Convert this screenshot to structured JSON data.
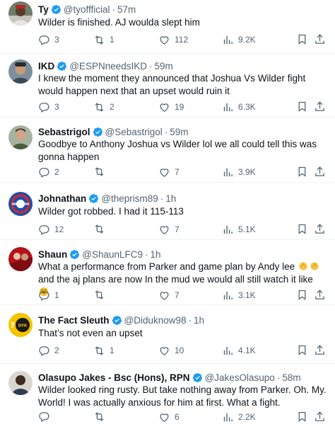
{
  "tweets": [
    {
      "name": "Ty",
      "handle": "@tyoffficial",
      "time": "57m",
      "text": "Wilder is finished. AJ woulda slept him",
      "replies": "3",
      "retweets": "1",
      "likes": "112",
      "views": "9.2K",
      "avatar_icon": "man-avatar-icon"
    },
    {
      "name": "IKD",
      "handle": "@ESPNneedsIKD",
      "time": "59m",
      "text": "I knew the moment they announced that Joshua Vs Wilder fight would happen next that an upset would ruin it",
      "replies": "3",
      "retweets": "2",
      "likes": "19",
      "views": "6.3K",
      "avatar_icon": "man-avatar-icon"
    },
    {
      "name": "Sebastrigol",
      "handle": "@Sebastrigol",
      "time": "59m",
      "text": "Goodbye to Anthony Joshua vs Wilder lol we all could tell this was gonna happen",
      "replies": "2",
      "retweets": "",
      "likes": "7",
      "views": "3.9K",
      "avatar_icon": "man-avatar-icon"
    },
    {
      "name": "Johnathan",
      "handle": "@theprism89",
      "time": "1h",
      "text": "Wilder got robbed. I had it 115-113",
      "replies": "12",
      "retweets": "",
      "likes": "7",
      "views": "5.1K",
      "avatar_icon": "logo-avatar-icon"
    },
    {
      "name": "Shaun",
      "handle": "@ShaunLFC9",
      "time": "1h",
      "text_before": "What a performance from Parker and game plan by Andy lee ",
      "text_middle": " and the aj plans are now In the mud we would all still watch it like ",
      "emoji_1": "clapping-hands-emoji",
      "emoji_2": "clapping-hands-emoji",
      "emoji_3": "tears-of-joy-emoji",
      "replies": "1",
      "retweets": "",
      "likes": "7",
      "views": "3.1K",
      "avatar_icon": "team-avatar-icon"
    },
    {
      "name": "The Fact Sleuth",
      "handle": "@Diduknow98",
      "time": "1h",
      "text": "That’s not even an upset",
      "replies": "2",
      "retweets": "1",
      "likes": "10",
      "views": "4.1K",
      "avatar_icon": "did-you-know-avatar-icon"
    },
    {
      "name": "Olasupo Jakes - Bsc (Hons), RPN",
      "handle": "@JakesOlasupo",
      "time": "58m",
      "text": "Wilder looked ring rusty. But take nothing away from Parker. Oh. My. World! I was actually anxious for him at first. What a fight.",
      "replies": "",
      "retweets": "",
      "likes": "6",
      "views": "2.2K",
      "avatar_icon": "man-avatar-icon"
    }
  ],
  "colors": {
    "verified": "#1d9bf0",
    "text": "#0f1419",
    "muted": "#536471",
    "divider": "#eff3f4"
  },
  "separator": "·"
}
